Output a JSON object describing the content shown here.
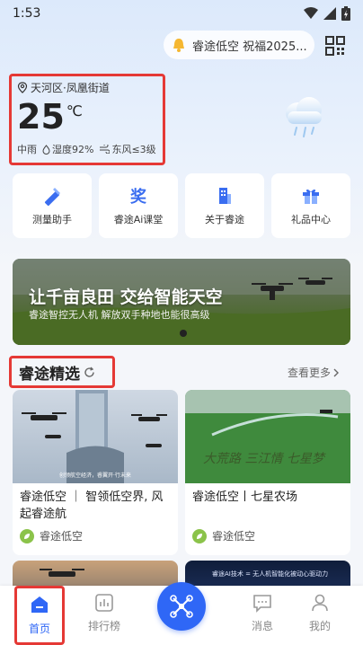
{
  "status": {
    "time": "1:53"
  },
  "header": {
    "notice_text": "睿途低空 祝福2025..."
  },
  "weather": {
    "location": "天河区·凤凰街道",
    "temperature": "25",
    "unit": "℃",
    "condition": "中雨",
    "humidity": "湿度92%",
    "wind": "东风≤3级"
  },
  "quick_links": [
    {
      "label": "测量助手",
      "icon": "ruler-pencil-icon"
    },
    {
      "label": "睿途Ai课堂",
      "icon": "award-icon"
    },
    {
      "label": "关于睿途",
      "icon": "building-icon"
    },
    {
      "label": "礼品中心",
      "icon": "gift-icon"
    }
  ],
  "banner": {
    "title": "让千亩良田 交给智能天空",
    "subtitle": "睿途智控无人机 解放双手种地也能很高级"
  },
  "featured": {
    "title": "睿途精选",
    "see_more": "查看更多"
  },
  "cards": [
    {
      "title": "睿途低空 ｜ 智领低空界, 风起睿途航",
      "author": "睿途低空",
      "caption": "创领航空经济，睿翼开·行未来"
    },
    {
      "title": "睿途低空丨七星农场",
      "author": "睿途低空",
      "caption": "大荒路 三江情 七星梦"
    }
  ],
  "lower_cards": [
    {
      "caption": ""
    },
    {
      "caption": "睿途AI技术 = 无人机智能化被动心驱动力"
    }
  ],
  "nav": {
    "home": "首页",
    "ranking": "排行榜",
    "messages": "消息",
    "me": "我的"
  },
  "colors": {
    "accent": "#2f67f6",
    "highlight_border": "#e53935"
  }
}
